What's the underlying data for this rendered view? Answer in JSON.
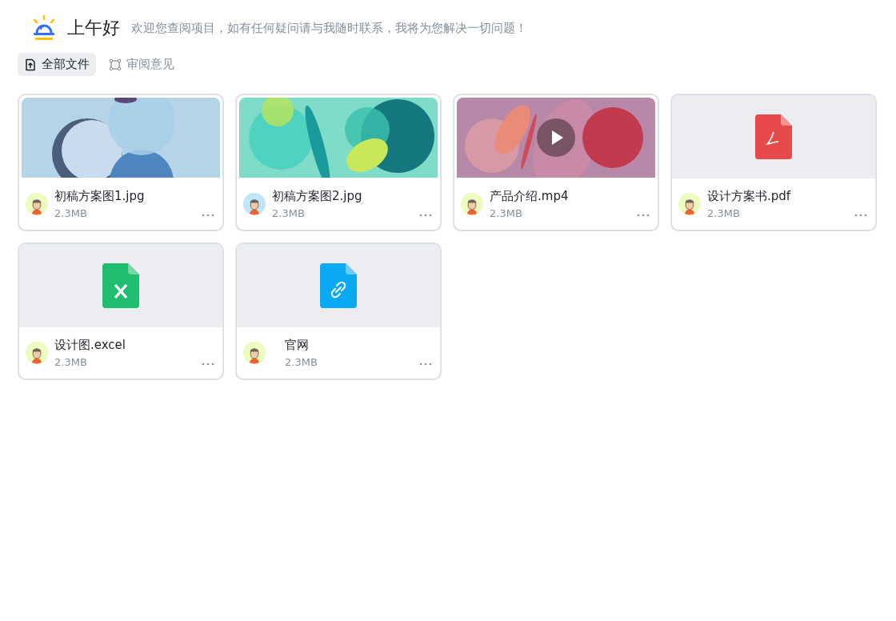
{
  "header": {
    "title": "上午好",
    "subtitle": "欢迎您查阅项目，如有任何疑问请与我随时联系，我将为您解决一切问题！"
  },
  "tabs": [
    {
      "label": "全部文件",
      "kind": "upload",
      "selected": true
    },
    {
      "label": "审阅意见",
      "kind": "review",
      "selected": false
    }
  ],
  "files": [
    {
      "name": "初稿方案图1.jpg",
      "size": "2.3MB",
      "color": "#eefcc0"
    },
    {
      "name": "初稿方案图2.jpg",
      "size": "2.3MB",
      "kind": "image2",
      "color": "#bfe6fa"
    },
    {
      "name": "产品介绍.mp4",
      "size": "2.3MB",
      "kind": "video",
      "color": "#eefcc0"
    },
    {
      "name": "设计方案书.pdf",
      "size": "2.3MB",
      "kind": "pdf",
      "color": "#eefcc0"
    },
    {
      "name": "设计图.excel",
      "size": "2.3MB",
      "kind": "excel",
      "color": "#eefcc0"
    },
    {
      "name": "官网",
      "size": "2.3MB",
      "kind": "link",
      "color": "#eefcc0"
    }
  ]
}
